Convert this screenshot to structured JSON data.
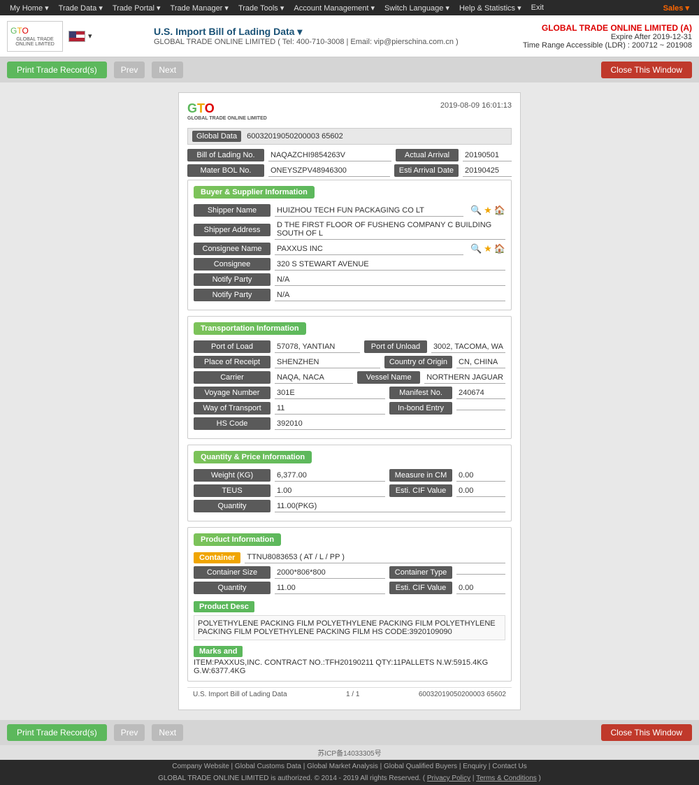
{
  "topnav": {
    "items": [
      {
        "label": "My Home ▾"
      },
      {
        "label": "Trade Data ▾"
      },
      {
        "label": "Trade Portal ▾"
      },
      {
        "label": "Trade Manager ▾"
      },
      {
        "label": "Trade Tools ▾"
      },
      {
        "label": "Account Management ▾"
      },
      {
        "label": "Switch Language ▾"
      },
      {
        "label": "Help & Statistics ▾"
      },
      {
        "label": "Exit"
      }
    ],
    "sales": "Sales ▾"
  },
  "header": {
    "title": "U.S. Import Bill of Lading Data ▾",
    "contact": "GLOBAL TRADE ONLINE LIMITED ( Tel: 400-710-3008 | Email: vip@pierschina.com.cn )",
    "company": "GLOBAL TRADE ONLINE LIMITED (A)",
    "expire": "Expire After 2019-12-31",
    "time_range": "Time Range Accessible (LDR) : 200712 ~ 201908"
  },
  "toolbar": {
    "print_label": "Print Trade Record(s)",
    "prev_label": "Prev",
    "next_label": "Next",
    "close_label": "Close This Window"
  },
  "card": {
    "datetime": "2019-08-09 16:01:13",
    "global_data_label": "Global Data",
    "global_data_value": "60032019050200003 65602",
    "bill_of_lading_no": "NAQAZCHI9854263V",
    "actual_arrival": "20190501",
    "master_bol_no": "ONEYSZPV48946300",
    "esti_arrival_date": "20190425"
  },
  "buyer_supplier": {
    "section_title": "Buyer & Supplier Information",
    "shipper_name": "HUIZHOU TECH FUN PACKAGING CO LT",
    "shipper_address": "D THE FIRST FLOOR OF FUSHENG COMPANY C BUILDING SOUTH OF L",
    "consignee_name": "PAXXUS INC",
    "consignee": "320 S STEWART AVENUE",
    "notify_party_1": "N/A",
    "notify_party_2": "N/A"
  },
  "transportation": {
    "section_title": "Transportation Information",
    "port_of_load": "57078, YANTIAN",
    "port_of_unload": "3002, TACOMA, WA",
    "place_of_receipt": "SHENZHEN",
    "country_of_origin": "CN, CHINA",
    "carrier": "NAQA, NACA",
    "vessel_name": "NORTHERN JAGUAR",
    "voyage_number": "301E",
    "manifest_no": "240674",
    "way_of_transport": "11",
    "in_bond_entry": "",
    "hs_code": "392010"
  },
  "quantity_price": {
    "section_title": "Quantity & Price Information",
    "weight_kg": "6,377.00",
    "measure_in_cm": "0.00",
    "teus": "1.00",
    "esti_cif_value_1": "0.00",
    "quantity": "11.00(PKG)"
  },
  "product": {
    "section_title": "Product Information",
    "container_label": "Container",
    "container_value": "TTNU8083653 ( AT / L / PP )",
    "container_size": "2000*806*800",
    "container_type": "",
    "quantity": "11.00",
    "esti_cif_value": "0.00",
    "product_desc_label": "Product Desc",
    "product_desc": "POLYETHYLENE PACKING FILM POLYETHYLENE PACKING FILM POLYETHYLENE PACKING FILM POLYETHYLENE PACKING FILM HS CODE:3920109090",
    "marks_label": "Marks and",
    "marks_value": "ITEM:PAXXUS,INC. CONTRACT NO.:TFH20190211 QTY:11PALLETS N.W:5915.4KG G.W:6377.4KG"
  },
  "record_footer": {
    "left": "U.S. Import Bill of Lading Data",
    "center": "1 / 1",
    "right": "60032019050200003 65602"
  },
  "footer": {
    "links": [
      "Company Website",
      "Global Customs Data",
      "Global Market Analysis",
      "Global Qualified Buyers",
      "Enquiry",
      "Contact Us"
    ],
    "legal": "GLOBAL TRADE ONLINE LIMITED is authorized. © 2014 - 2019 All rights Reserved.  ( Privacy Policy  |  Terms & Conditions )",
    "icp": "苏ICP备14033305号"
  },
  "labels": {
    "global_data": "Global Data",
    "bill_of_lading_no": "Bill of Lading No.",
    "actual_arrival": "Actual Arrival",
    "master_bol_no": "Mater BOL No.",
    "esti_arrival_date": "Esti Arrival Date",
    "shipper_name": "Shipper Name",
    "shipper_address": "Shipper Address",
    "consignee_name": "Consignee Name",
    "consignee": "Consignee",
    "notify_party": "Notify Party",
    "port_of_load": "Port of Load",
    "port_of_unload": "Port of Unload",
    "place_of_receipt": "Place of Receipt",
    "country_of_origin": "Country of Origin",
    "carrier": "Carrier",
    "vessel_name": "Vessel Name",
    "voyage_number": "Voyage Number",
    "manifest_no": "Manifest No.",
    "way_of_transport": "Way of Transport",
    "in_bond_entry": "In-bond Entry",
    "hs_code": "HS Code",
    "weight_kg": "Weight (KG)",
    "measure_in_cm": "Measure in CM",
    "teus": "TEUS",
    "esti_cif_value": "Esti. CIF Value",
    "quantity": "Quantity",
    "container": "Container",
    "container_size": "Container Size",
    "container_type": "Container Type"
  }
}
